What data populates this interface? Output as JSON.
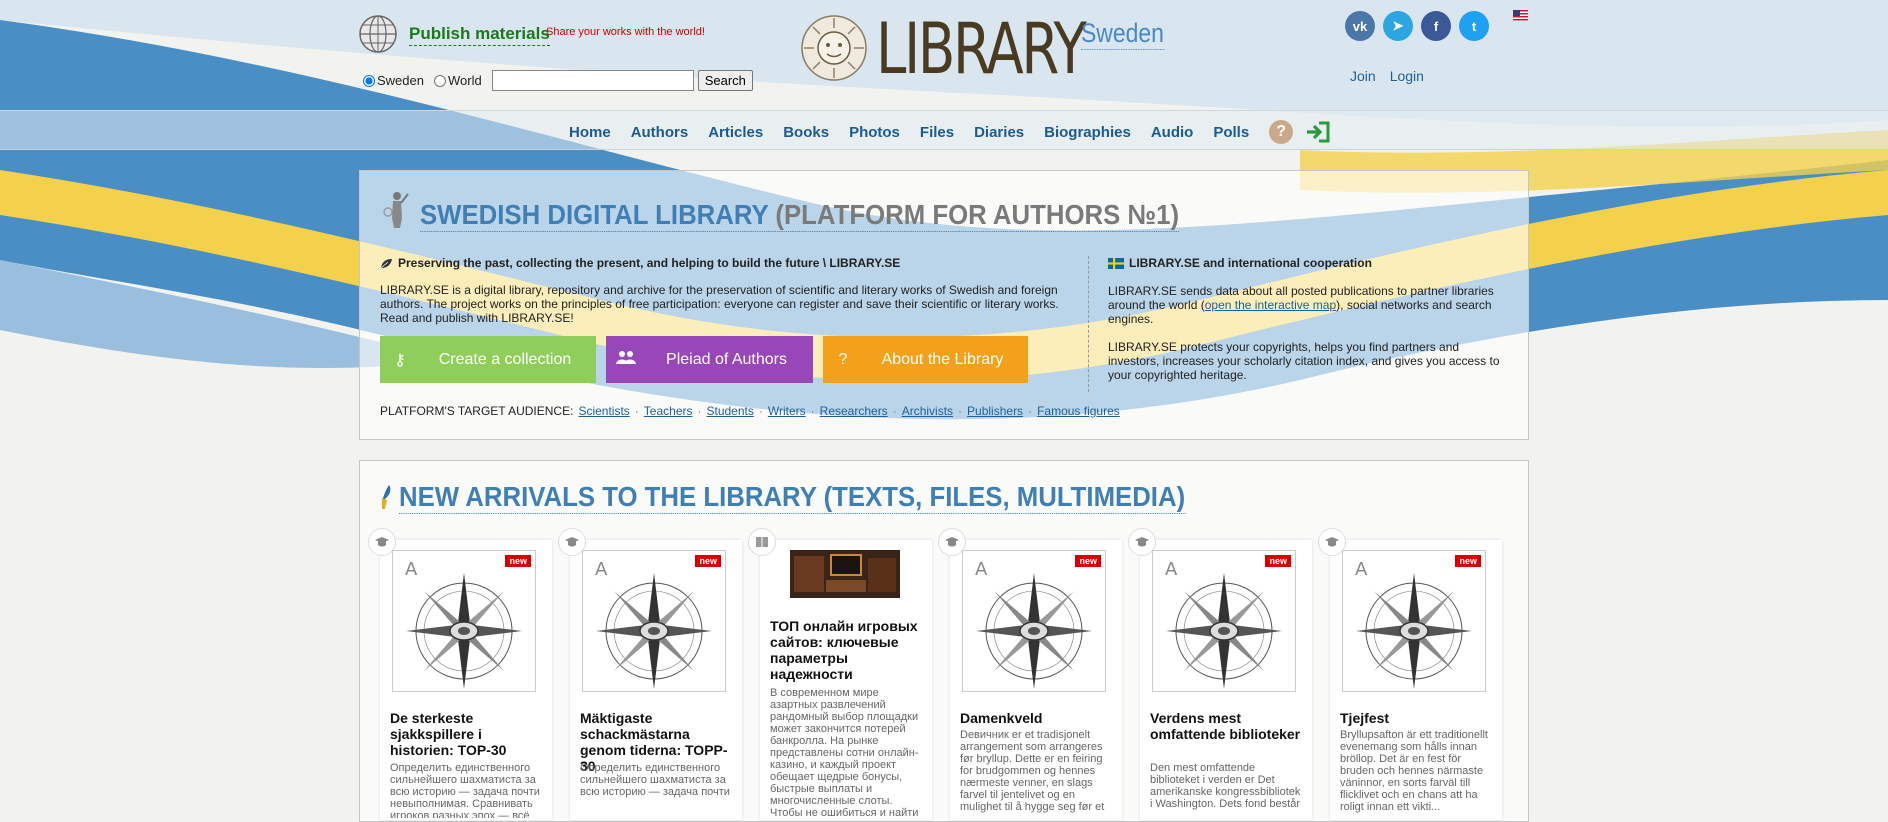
{
  "header": {
    "publish_label": "Publish materials",
    "share_tagline": "Share your works with the world!",
    "scope_sweden": "Sweden",
    "scope_world": "World",
    "search_value": "",
    "search_button": "Search",
    "logo_title": "LIBRARY",
    "logo_country": "Sweden",
    "socials": [
      {
        "name": "vk-icon",
        "glyph": "vk",
        "color": "#4a76a8"
      },
      {
        "name": "telegram-icon",
        "glyph": "➤",
        "color": "#2ca5e0"
      },
      {
        "name": "facebook-icon",
        "glyph": "f",
        "color": "#3b5998"
      },
      {
        "name": "twitter-icon",
        "glyph": "t",
        "color": "#1da1f2"
      }
    ],
    "join": "Join",
    "login": "Login"
  },
  "nav": {
    "items": [
      "Home",
      "Authors",
      "Articles",
      "Books",
      "Photos",
      "Files",
      "Diaries",
      "Biographies",
      "Audio",
      "Polls"
    ]
  },
  "intro": {
    "title_main": "SWEDISH DIGITAL LIBRARY",
    "title_sub": "(PLATFORM FOR AUTHORS №1)",
    "tagline_left": "Preserving the past, collecting the present, and helping to build the future \\ LIBRARY.SE",
    "desc_left": "LIBRARY.SE is a digital library, repository and archive for the preservation of scientific and literary works of Swedish and foreign authors. The project works on the principles of free participation: everyone can register and save their scientific or literary works. Read and publish with LIBRARY.SE!",
    "buttons": [
      "Create a collection",
      "Pleiad of Authors",
      "About the Library"
    ],
    "audience_label": "PLATFORM'S TARGET AUDIENCE:",
    "audience": [
      "Scientists",
      "Teachers",
      "Students",
      "Writers",
      "Researchers",
      "Archivists",
      "Publishers",
      "Famous figures"
    ],
    "tagline_right": "LIBRARY.SE and international cooperation",
    "desc_right1_a": "LIBRARY.SE sends data about all posted publications to partner libraries around the world (",
    "desc_right1_link": "open the interactive map",
    "desc_right1_b": "), social networks and search engines.",
    "desc_right2": "LIBRARY.SE protects your copyrights, helps you find partners and investors, increases your scholarly citation index, and gives you access to your copyrighted heritage."
  },
  "arrivals": {
    "title": "NEW ARRIVALS TO THE LIBRARY (TEXTS, FILES, MULTIMEDIA)",
    "new_label": "new",
    "cards": [
      {
        "title": "De sterkeste sjakkspillere i historien: TOP-30",
        "desc": "Определить единственного сильнейшего шахматиста за всю историю — задача почти невыполнимая. Сравнивать игроков разных эпох — всё равно что"
      },
      {
        "title": "Mäktigaste schackmästarna genom tiderna: TOPP-30",
        "desc": "Определить единственного сильнейшего шахматиста за всю историю — задача почти"
      },
      {
        "title": "ТОП онлайн игровых сайтов: ключевые параметры надежности",
        "desc": "В современном мире азартных развлечений рандомный выбор площадки может закончится потерей банкролла. На рынке представлены сотни онлайн-казино, и каждый проект обещает щедрые бонусы, быстрые выплаты и многочисленные слоты. Чтобы не ошибиться и найти"
      },
      {
        "title": "Damenkveld",
        "desc": "Dевичник er et tradisjonelt arrangement som arrangeres før bryllup. Dette er en feiring for brudgommen og hennes nærmeste venner, en slags farvel til jentelivet og en mulighet til å hygge seg før et"
      },
      {
        "title": "Verdens mest omfattende biblioteker",
        "desc": "Den mest omfattende biblioteket i verden er Det amerikanske kongressbibliotek i Washington. Dets fond består"
      },
      {
        "title": "Tjejfest",
        "desc": "Bryllupsaftоn är ett traditionellt evenemang som hålls innan bröllop. Det är en fest för bruden och hennes närmaste väninnor, en sorts farväl till flicklivet och en chans att ha roligt innan ett vikti..."
      }
    ]
  },
  "colors": {
    "accent_blue": "#3f7fb5",
    "nav_blue": "#1a5c92",
    "publish_green": "#1a7a1a",
    "button_green": "#8fce5a",
    "button_purple": "#9847b8",
    "button_orange": "#f3a11b",
    "badge_red": "#d60000"
  }
}
